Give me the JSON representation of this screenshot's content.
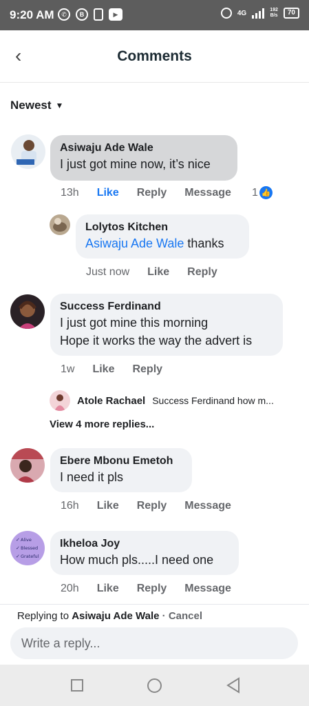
{
  "status_bar": {
    "time": "9:20 AM",
    "icons": [
      "whatsapp-icon",
      "b-icon",
      "sim-icon",
      "youtube-icon"
    ],
    "network": "4G",
    "net_speed_top": "192",
    "net_speed_bottom": "B/s",
    "battery": "70"
  },
  "header": {
    "title": "Comments",
    "back_icon": "chevron-left-icon"
  },
  "sort": {
    "label": "Newest"
  },
  "comments": [
    {
      "name": "Asiwaju Ade Wale",
      "text": "I just got mine now, it’s nice",
      "time": "13h",
      "like": "Like",
      "reply": "Reply",
      "message": "Message",
      "reactions": "1",
      "replies": [
        {
          "name": "Lolytos Kitchen",
          "mention": "Asiwaju Ade Wale",
          "text": " thanks",
          "time": "Just now",
          "like": "Like",
          "reply": "Reply"
        }
      ]
    },
    {
      "name": "Success Ferdinand",
      "text_line1": "I just got mine this morning",
      "text_line2": "Hope it works the way the advert is",
      "time": "1w",
      "like": "Like",
      "reply": "Reply",
      "reply_preview": {
        "name": "Atole Rachael",
        "text": "Success Ferdinand how m..."
      },
      "view_more": "View 4 more replies..."
    },
    {
      "name": "Ebere Mbonu Emetoh",
      "text": "I need it pls",
      "time": "16h",
      "like": "Like",
      "reply": "Reply",
      "message": "Message"
    },
    {
      "name": "Ikheloa Joy",
      "text": "How much pls.....I need one",
      "time": "20h",
      "like": "Like",
      "reply": "Reply",
      "message": "Message",
      "avatar_lines": [
        "Alive",
        "Blessed",
        "Grateful"
      ]
    }
  ],
  "reply_bar": {
    "prefix": "Replying to",
    "target": "Asiwaju Ade Wale",
    "separator": "·",
    "cancel": "Cancel",
    "placeholder": "Write a reply..."
  },
  "colors": {
    "link": "#1877f2",
    "bubble": "#f0f2f5",
    "status_bar": "#5d5d5d"
  }
}
